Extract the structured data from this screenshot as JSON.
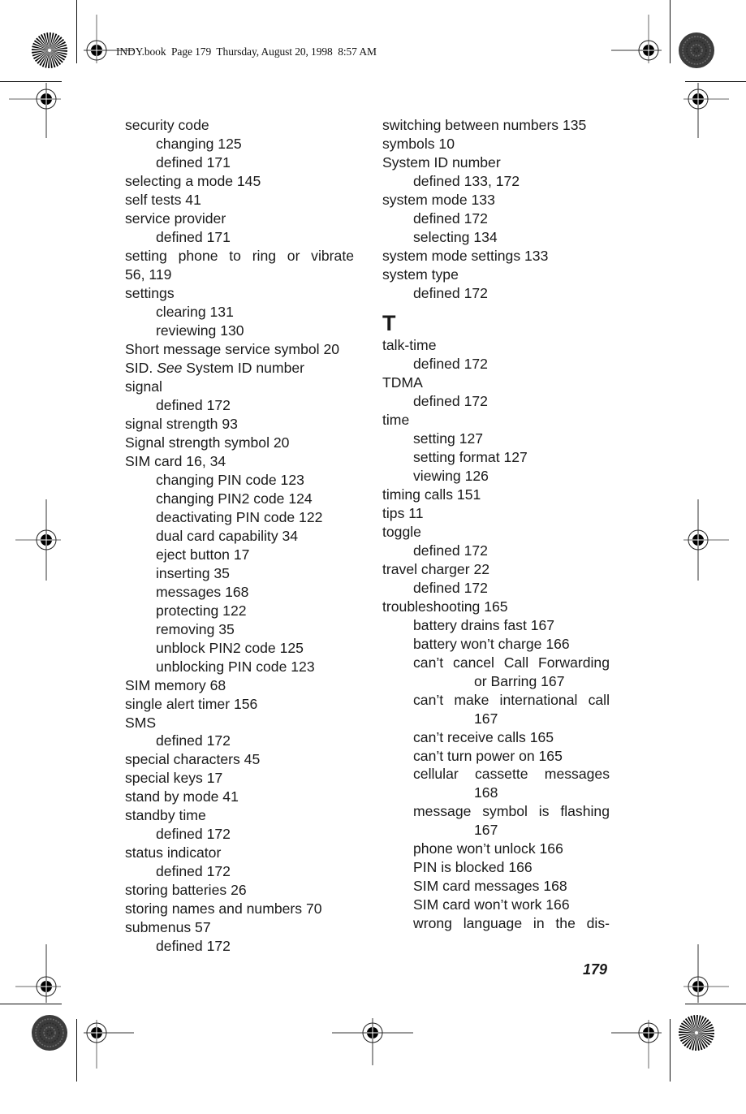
{
  "header": {
    "slug": "INDY.book  Page 179  Thursday, August 20, 1998  8:57 AM"
  },
  "page_number": "179",
  "left_column": [
    {
      "level": 0,
      "text": "security code"
    },
    {
      "level": 1,
      "text": "changing 125"
    },
    {
      "level": 1,
      "text": "defined 171"
    },
    {
      "level": 0,
      "text": "selecting a mode 145"
    },
    {
      "level": 0,
      "text": "self tests 41"
    },
    {
      "level": 0,
      "text": "service provider"
    },
    {
      "level": 1,
      "text": "defined 171"
    },
    {
      "level": 0,
      "text": "setting phone to ring or vibrate",
      "justify": true
    },
    {
      "level": 0,
      "text": "56, 119"
    },
    {
      "level": 0,
      "text": "settings"
    },
    {
      "level": 1,
      "text": "clearing 131"
    },
    {
      "level": 1,
      "text": "reviewing 130"
    },
    {
      "level": 0,
      "text": "Short message service symbol 20"
    },
    {
      "level": 0,
      "text": "SID. ",
      "see": "See",
      "after": " System ID number"
    },
    {
      "level": 0,
      "text": "signal"
    },
    {
      "level": 1,
      "text": "defined 172"
    },
    {
      "level": 0,
      "text": "signal strength 93"
    },
    {
      "level": 0,
      "text": "Signal strength symbol 20"
    },
    {
      "level": 0,
      "text": "SIM card 16, 34"
    },
    {
      "level": 1,
      "text": "changing PIN code 123"
    },
    {
      "level": 1,
      "text": "changing PIN2 code 124"
    },
    {
      "level": 1,
      "text": "deactivating PIN code 122"
    },
    {
      "level": 1,
      "text": "dual card capability 34"
    },
    {
      "level": 1,
      "text": "eject button 17"
    },
    {
      "level": 1,
      "text": "inserting 35"
    },
    {
      "level": 1,
      "text": "messages 168"
    },
    {
      "level": 1,
      "text": "protecting 122"
    },
    {
      "level": 1,
      "text": "removing 35"
    },
    {
      "level": 1,
      "text": "unblock PIN2 code 125"
    },
    {
      "level": 1,
      "text": "unblocking PIN code 123"
    },
    {
      "level": 0,
      "text": "SIM memory 68"
    },
    {
      "level": 0,
      "text": "single alert timer 156"
    },
    {
      "level": 0,
      "text": "SMS"
    },
    {
      "level": 1,
      "text": "defined 172"
    },
    {
      "level": 0,
      "text": "special characters 45"
    },
    {
      "level": 0,
      "text": "special keys 17"
    },
    {
      "level": 0,
      "text": "stand by mode 41"
    },
    {
      "level": 0,
      "text": "standby time"
    },
    {
      "level": 1,
      "text": "defined 172"
    },
    {
      "level": 0,
      "text": "status indicator"
    },
    {
      "level": 1,
      "text": "defined 172"
    },
    {
      "level": 0,
      "text": "storing batteries 26"
    },
    {
      "level": 0,
      "text": "storing names and numbers 70"
    },
    {
      "level": 0,
      "text": "submenus 57"
    },
    {
      "level": 1,
      "text": "defined 172"
    }
  ],
  "right_column": [
    {
      "level": 0,
      "text": "switching between numbers 135"
    },
    {
      "level": 0,
      "text": "symbols 10"
    },
    {
      "level": 0,
      "text": "System ID number"
    },
    {
      "level": 1,
      "text": "defined 133, 172"
    },
    {
      "level": 0,
      "text": "system mode 133"
    },
    {
      "level": 1,
      "text": "defined 172"
    },
    {
      "level": 1,
      "text": "selecting 134"
    },
    {
      "level": 0,
      "text": "system mode settings 133"
    },
    {
      "level": 0,
      "text": "system type"
    },
    {
      "level": 1,
      "text": "defined 172"
    },
    {
      "section": "T"
    },
    {
      "level": 0,
      "text": "talk-time"
    },
    {
      "level": 1,
      "text": "defined 172"
    },
    {
      "level": 0,
      "text": "TDMA"
    },
    {
      "level": 1,
      "text": "defined 172"
    },
    {
      "level": 0,
      "text": "time"
    },
    {
      "level": 1,
      "text": "setting 127"
    },
    {
      "level": 1,
      "text": "setting format 127"
    },
    {
      "level": 1,
      "text": "viewing 126"
    },
    {
      "level": 0,
      "text": "timing calls 151"
    },
    {
      "level": 0,
      "text": "tips 11"
    },
    {
      "level": 0,
      "text": "toggle"
    },
    {
      "level": 1,
      "text": "defined 172"
    },
    {
      "level": 0,
      "text": "travel charger 22"
    },
    {
      "level": 1,
      "text": "defined 172"
    },
    {
      "level": 0,
      "text": "troubleshooting 165"
    },
    {
      "level": 1,
      "text": "battery drains fast 167"
    },
    {
      "level": 1,
      "text": "battery won’t charge 166"
    },
    {
      "level": 1,
      "text": "can’t cancel Call Forwarding",
      "justify": true
    },
    {
      "level": 2,
      "text": "or Barring 167"
    },
    {
      "level": 1,
      "text": "can’t make international call",
      "justify": true
    },
    {
      "level": 2,
      "text": "167"
    },
    {
      "level": 1,
      "text": "can’t receive calls 165"
    },
    {
      "level": 1,
      "text": "can’t turn power on 165"
    },
    {
      "level": 1,
      "text": "cellular cassette messages",
      "justify": true
    },
    {
      "level": 2,
      "text": "168"
    },
    {
      "level": 1,
      "text": "message symbol is flashing",
      "justify": true
    },
    {
      "level": 2,
      "text": "167"
    },
    {
      "level": 1,
      "text": "phone won’t unlock 166"
    },
    {
      "level": 1,
      "text": "PIN is blocked 166"
    },
    {
      "level": 1,
      "text": "SIM card messages 168"
    },
    {
      "level": 1,
      "text": "SIM card won’t work 166"
    },
    {
      "level": 1,
      "text": "wrong language in the dis-",
      "justify": true
    }
  ],
  "registration_marks": {
    "crosshair": "registration-crosshair-icon",
    "starburst": "starburst-target-icon",
    "gray_disc": "halftone-disc-icon"
  }
}
